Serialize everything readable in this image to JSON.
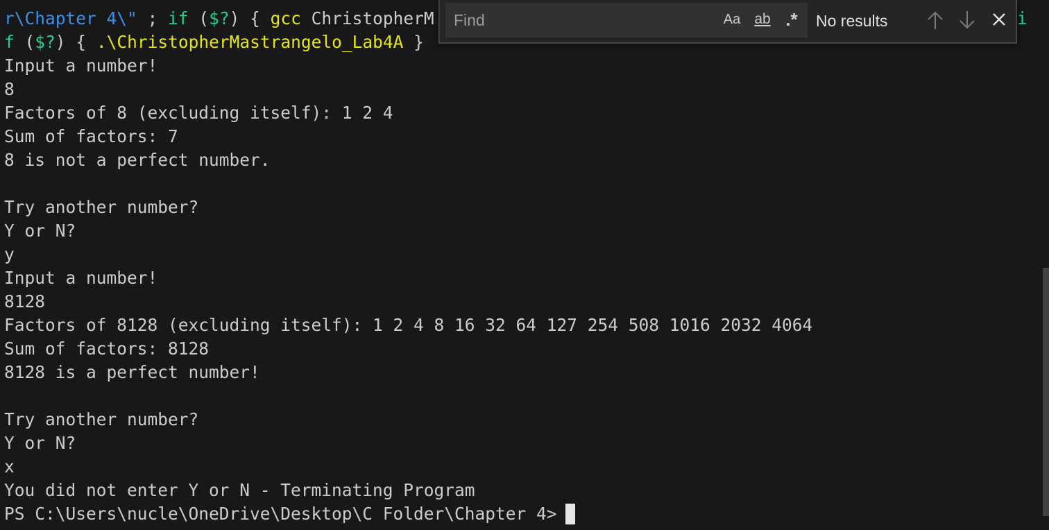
{
  "terminal": {
    "cmd_line_1": {
      "part1": "r\\Chapter 4\\\"",
      "part2": " ; ",
      "part3": "if",
      "part4": " (",
      "part5": "$?",
      "part6": ") { ",
      "part7": "gcc",
      "part8": " ChristopherM"
    },
    "right_fragment": "i",
    "cmd_line_2": {
      "part1": "f",
      "part2": " (",
      "part3": "$?",
      "part4": ") { ",
      "part5": ".\\ChristopherMastrangelo_Lab4A",
      "part6": " }"
    },
    "output_lines": [
      "Input a number!",
      "8",
      "Factors of 8 (excluding itself): 1 2 4",
      "Sum of factors: 7",
      "8 is not a perfect number.",
      "",
      "Try another number?",
      "Y or N?",
      "y",
      "Input a number!",
      "8128",
      "Factors of 8128 (excluding itself): 1 2 4 8 16 32 64 127 254 508 1016 2032 4064",
      "Sum of factors: 8128",
      "8128 is a perfect number!",
      "",
      "Try another number?",
      "Y or N?",
      "x",
      "You did not enter Y or N - Terminating Program"
    ],
    "prompt": "PS C:\\Users\\nucle\\OneDrive\\Desktop\\C Folder\\Chapter 4>"
  },
  "find_widget": {
    "placeholder": "Find",
    "match_case_label": "Aa",
    "whole_word_label": "ab",
    "regex_label": ".*",
    "status": "No results",
    "icons": {
      "previous": "arrow-up-icon",
      "next": "arrow-down-icon",
      "close": "close-icon"
    }
  },
  "colors": {
    "background": "#181818",
    "foreground": "#cccccc",
    "keyword_blue": "#3b8eea",
    "control_green": "#23d18b",
    "command_yellow": "#e5e510"
  }
}
